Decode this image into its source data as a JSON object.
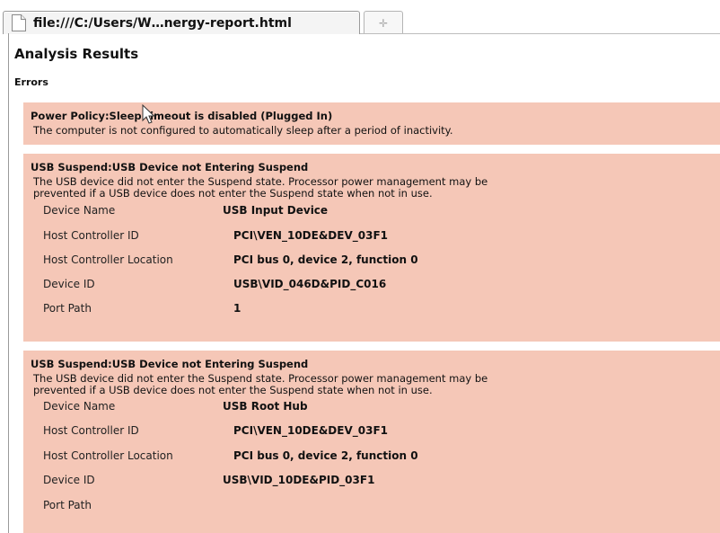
{
  "tab": {
    "title": "file:///C:/Users/W…nergy-report.html"
  },
  "page": {
    "heading": "Analysis Results",
    "section": "Errors"
  },
  "errors": [
    {
      "title": "Power Policy:Sleep timeout is disabled (Plugged In)",
      "desc": [
        "The computer is not configured to automatically sleep after a period of inactivity."
      ]
    },
    {
      "title": "USB Suspend:USB Device not Entering Suspend",
      "desc": [
        "The USB device did not enter the Suspend state. Processor power management may be",
        "prevented if a USB device does not enter the Suspend state when not in use."
      ],
      "details": [
        {
          "label": "Device Name",
          "value": "USB Input Device"
        },
        {
          "label": "Host Controller ID",
          "value": "PCI\\VEN_10DE&DEV_03F1"
        },
        {
          "label": "Host Controller Location",
          "value": "PCI bus 0, device 2, function 0"
        },
        {
          "label": "Device ID",
          "value": "USB\\VID_046D&PID_C016"
        },
        {
          "label": "Port Path",
          "value": "1"
        }
      ]
    },
    {
      "title": "USB Suspend:USB Device not Entering Suspend",
      "desc": [
        "The USB device did not enter the Suspend state. Processor power management may be",
        "prevented if a USB device does not enter the Suspend state when not in use."
      ],
      "details": [
        {
          "label": "Device Name",
          "value": "USB Root Hub"
        },
        {
          "label": "Host Controller ID",
          "value": "PCI\\VEN_10DE&DEV_03F1"
        },
        {
          "label": "Host Controller Location",
          "value": "PCI bus 0, device 2, function 0"
        },
        {
          "label": "Device ID",
          "value": "USB\\VID_10DE&PID_03F1"
        },
        {
          "label": "Port Path",
          "value": ""
        }
      ]
    }
  ],
  "colors": {
    "error_bg": "#f5c7b7"
  },
  "icons": {
    "tab": "page-icon",
    "new_tab": "new-tab-icon",
    "cursor": "mouse-pointer-icon"
  }
}
